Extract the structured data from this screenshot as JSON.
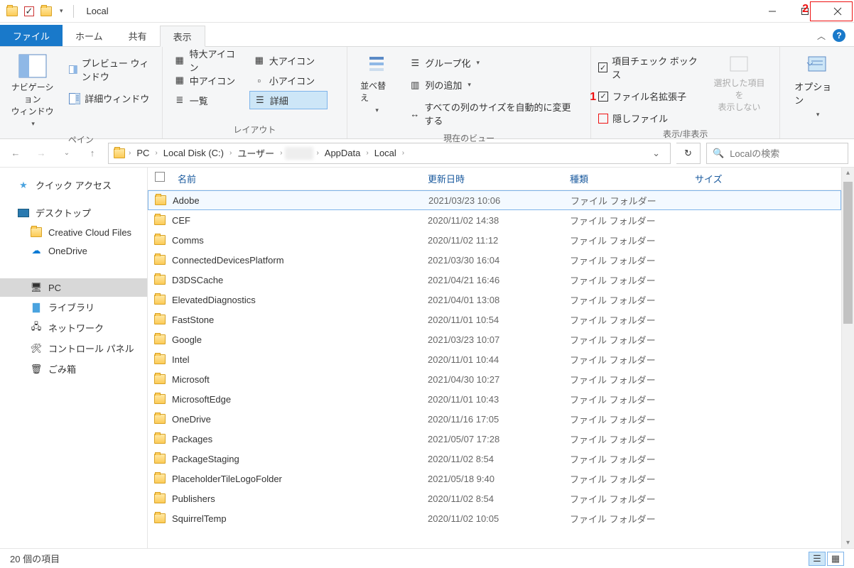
{
  "window": {
    "title": "Local"
  },
  "annotations": {
    "one": "1",
    "two": "2"
  },
  "tabs": {
    "file": "ファイル",
    "home": "ホーム",
    "share": "共有",
    "view": "表示"
  },
  "ribbon": {
    "pane": {
      "nav_pane": "ナビゲーション\nウィンドウ",
      "preview": "プレビュー ウィンドウ",
      "details": "詳細ウィンドウ",
      "group_label": "ペイン"
    },
    "layout": {
      "extra_large": "特大アイコン",
      "large": "大アイコン",
      "medium": "中アイコン",
      "small": "小アイコン",
      "list": "一覧",
      "details": "詳細",
      "group_label": "レイアウト"
    },
    "current_view": {
      "sort": "並べ替え",
      "group_by": "グループ化",
      "add_columns": "列の追加",
      "size_all": "すべての列のサイズを自動的に変更する",
      "group_label": "現在のビュー"
    },
    "show_hide": {
      "item_check": "項目チェック ボックス",
      "extensions": "ファイル名拡張子",
      "hidden": "隠しファイル",
      "hide_selected": "選択した項目を\n表示しない",
      "group_label": "表示/非表示"
    },
    "options": {
      "label": "オプション"
    }
  },
  "breadcrumbs": {
    "pc": "PC",
    "c": "Local Disk (C:)",
    "users": "ユーザー",
    "appdata": "AppData",
    "local": "Local"
  },
  "search": {
    "placeholder": "Localの検索"
  },
  "columns": {
    "name": "名前",
    "date": "更新日時",
    "type": "種類",
    "size": "サイズ"
  },
  "tree": {
    "quick_access": "クイック アクセス",
    "desktop": "デスクトップ",
    "creative_cloud": "Creative Cloud Files",
    "onedrive": "OneDrive",
    "pc": "PC",
    "libraries": "ライブラリ",
    "network": "ネットワーク",
    "control_panel": "コントロール パネル",
    "recycle": "ごみ箱"
  },
  "rows": [
    {
      "name": "Adobe",
      "date": "2021/03/23 10:06",
      "type": "ファイル フォルダー",
      "selected": true
    },
    {
      "name": "CEF",
      "date": "2020/11/02 14:38",
      "type": "ファイル フォルダー"
    },
    {
      "name": "Comms",
      "date": "2020/11/02 11:12",
      "type": "ファイル フォルダー"
    },
    {
      "name": "ConnectedDevicesPlatform",
      "date": "2021/03/30 16:04",
      "type": "ファイル フォルダー"
    },
    {
      "name": "D3DSCache",
      "date": "2021/04/21 16:46",
      "type": "ファイル フォルダー"
    },
    {
      "name": "ElevatedDiagnostics",
      "date": "2021/04/01 13:08",
      "type": "ファイル フォルダー"
    },
    {
      "name": "FastStone",
      "date": "2020/11/01 10:54",
      "type": "ファイル フォルダー"
    },
    {
      "name": "Google",
      "date": "2021/03/23 10:07",
      "type": "ファイル フォルダー"
    },
    {
      "name": "Intel",
      "date": "2020/11/01 10:44",
      "type": "ファイル フォルダー"
    },
    {
      "name": "Microsoft",
      "date": "2021/04/30 10:27",
      "type": "ファイル フォルダー"
    },
    {
      "name": "MicrosoftEdge",
      "date": "2020/11/01 10:43",
      "type": "ファイル フォルダー"
    },
    {
      "name": "OneDrive",
      "date": "2020/11/16 17:05",
      "type": "ファイル フォルダー"
    },
    {
      "name": "Packages",
      "date": "2021/05/07 17:28",
      "type": "ファイル フォルダー"
    },
    {
      "name": "PackageStaging",
      "date": "2020/11/02 8:54",
      "type": "ファイル フォルダー"
    },
    {
      "name": "PlaceholderTileLogoFolder",
      "date": "2021/05/18 9:40",
      "type": "ファイル フォルダー"
    },
    {
      "name": "Publishers",
      "date": "2020/11/02 8:54",
      "type": "ファイル フォルダー"
    },
    {
      "name": "SquirrelTemp",
      "date": "2020/11/02 10:05",
      "type": "ファイル フォルダー"
    }
  ],
  "status": {
    "item_count": "20 個の項目"
  }
}
